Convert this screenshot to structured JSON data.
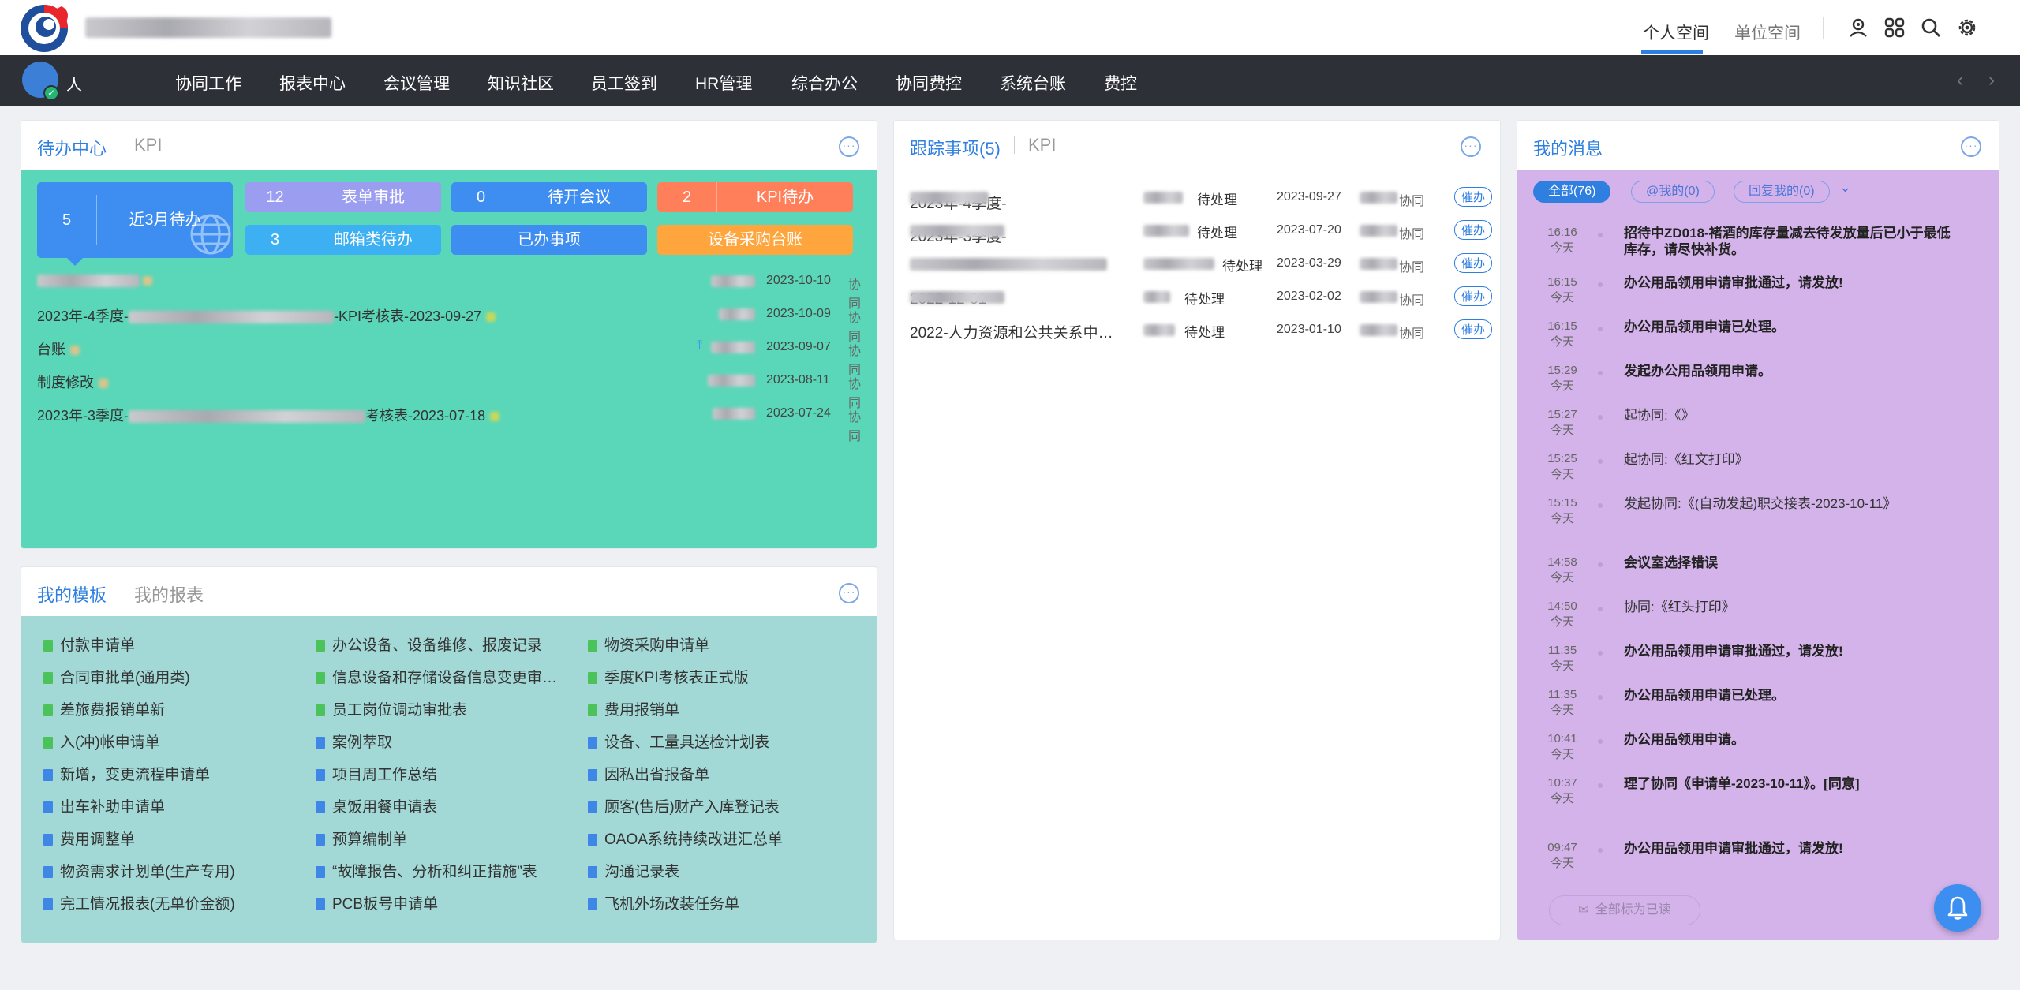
{
  "header": {
    "tabs": [
      "个人空间",
      "单位空间"
    ]
  },
  "nav": {
    "user_name": "人",
    "items": [
      "协同工作",
      "报表中心",
      "会议管理",
      "知识社区",
      "员工签到",
      "HR管理",
      "综合办公",
      "协同费控",
      "系统台账",
      "费控"
    ]
  },
  "todo": {
    "tab_active": "待办中心",
    "tab_other": "KPI",
    "big_tile": {
      "count": "5",
      "label": "近3月待办"
    },
    "tiles": [
      {
        "count": "12",
        "label": "表单审批",
        "color": "#9a9df0"
      },
      {
        "count": "0",
        "label": "待开会议",
        "color": "#3d8ef0"
      },
      {
        "count": "2",
        "label": "KPI待办",
        "color": "#ff7f5b"
      },
      {
        "count": "3",
        "label": "邮箱类待办",
        "color": "#3cb0f2"
      },
      {
        "count": "",
        "label": "已办事项",
        "color": "#3d8ef0"
      },
      {
        "count": "",
        "label": "设备采购台账",
        "color": "#ffa53d"
      }
    ],
    "rows": [
      {
        "pre": "",
        "post": "",
        "date": "2023-10-10",
        "type": "协同"
      },
      {
        "pre": "2023年-4季度-",
        "post": "-KPI考核表-2023-09-27",
        "date": "2023-10-09",
        "type": "协同"
      },
      {
        "pre": "台账",
        "post": "",
        "date": "2023-09-07",
        "type": "协同"
      },
      {
        "pre": "制度修改",
        "post": "",
        "date": "2023-08-11",
        "type": "协同"
      },
      {
        "pre": "2023年-3季度-",
        "post": "考核表-2023-07-18",
        "date": "2023-07-24",
        "type": "协同"
      }
    ]
  },
  "templates": {
    "tab_active": "我的模板",
    "tab_other": "我的报表",
    "col1": [
      "付款申请单",
      "合同审批单(通用类)",
      "差旅费报销单新",
      "入(冲)帐申请单",
      "新增，变更流程申请单",
      "出车补助申请单",
      "费用调整单",
      "物资需求计划单(生产专用)",
      "完工情况报表(无单价金额)"
    ],
    "col2": [
      "办公设备、设备维修、报废记录",
      "信息设备和存储设备信息变更审…",
      "员工岗位调动审批表",
      "案例萃取",
      "项目周工作总结",
      "桌饭用餐申请表",
      "预算编制单",
      "“故障报告、分析和纠正措施”表",
      "PCB板号申请单"
    ],
    "col3": [
      "物资采购申请单",
      "季度KPI考核表正式版",
      "费用报销单",
      "设备、工量具送检计划表",
      "因私出省报备单",
      "顾客(售后)财产入库登记表",
      "OAOA系统持续改进汇总单",
      "沟通记录表",
      "飞机外场改装任务单"
    ]
  },
  "tracking": {
    "tab_active": "跟踪事项(5)",
    "tab_other": "KPI",
    "urge_label": "催办",
    "rows": [
      {
        "title": "2023年-4季度-",
        "status": "待处理",
        "date": "2023-09-27",
        "type": "协同"
      },
      {
        "title": "2023年-3季度-",
        "status": "待处理",
        "date": "2023-07-20",
        "type": "协同"
      },
      {
        "title": "",
        "status": "待处理",
        "date": "2023-03-29",
        "type": "协同"
      },
      {
        "title": "2022-12-31-",
        "status": "待处理",
        "date": "2023-02-02",
        "type": "协同"
      },
      {
        "title": "2022-人力资源和公共关系中…",
        "status": "待处理",
        "date": "2023-01-10",
        "type": "协同"
      }
    ]
  },
  "messages": {
    "title": "我的消息",
    "filters": [
      "全部(76)",
      "@我的(0)",
      "回复我的(0)"
    ],
    "mark_all": "全部标为已读",
    "items": [
      {
        "time": "16:16",
        "day": "今天",
        "text": "招待中ZD018-褚酒的库存量减去待发放量后已小于最低库存，请尽快补货。",
        "bold": true
      },
      {
        "time": "16:15",
        "day": "今天",
        "text": "办公用品领用申请审批通过，请发放!",
        "bold": true
      },
      {
        "time": "16:15",
        "day": "今天",
        "text": "办公用品领用申请已处理。",
        "bold": true
      },
      {
        "time": "15:29",
        "day": "今天",
        "text": "发起办公用品领用申请。",
        "bold": true
      },
      {
        "time": "15:27",
        "day": "今天",
        "text": "起协同:《》",
        "bold": false
      },
      {
        "time": "15:25",
        "day": "今天",
        "text": "起协同:《红文打印》",
        "bold": false
      },
      {
        "time": "15:15",
        "day": "今天",
        "text": "发起协同:《(自动发起)职交接表-2023-10-11》",
        "bold": false
      },
      {
        "time": "14:58",
        "day": "今天",
        "text": "会议室选择错误",
        "bold": true
      },
      {
        "time": "14:50",
        "day": "今天",
        "text": "协同:《红头打印》",
        "bold": false
      },
      {
        "time": "11:35",
        "day": "今天",
        "text": "办公用品领用申请审批通过，请发放!",
        "bold": true
      },
      {
        "time": "11:35",
        "day": "今天",
        "text": "办公用品领用申请已处理。",
        "bold": true
      },
      {
        "time": "10:41",
        "day": "今天",
        "text": "办公用品领用申请。",
        "bold": true
      },
      {
        "time": "10:37",
        "day": "今天",
        "text": "理了协同《申请单-2023-10-11》。[同意]",
        "bold": true
      },
      {
        "time": "09:47",
        "day": "今天",
        "text": "办公用品领用申请审批通过，请发放!",
        "bold": true
      }
    ]
  }
}
